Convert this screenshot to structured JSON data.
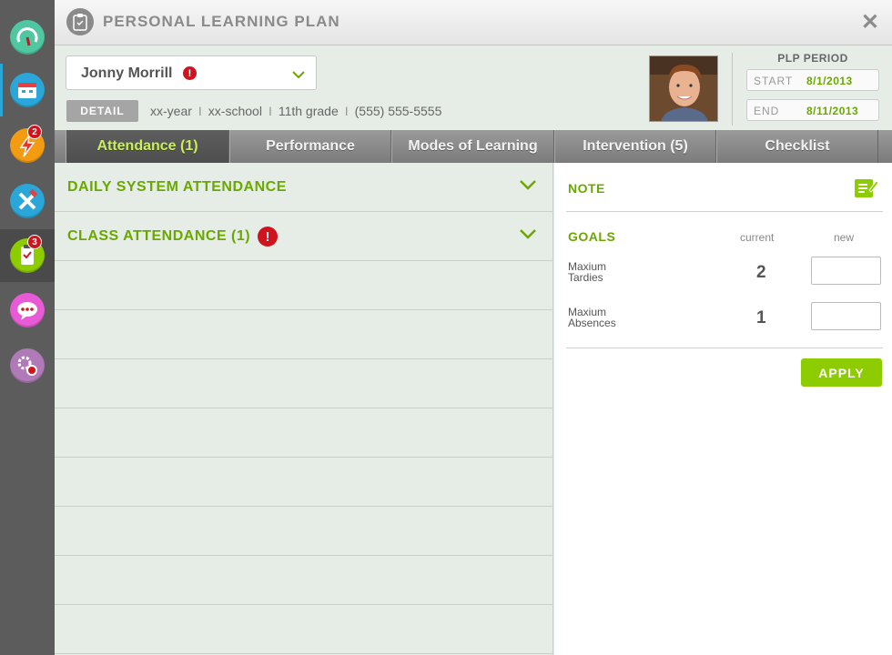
{
  "app": {
    "title": "PERSONAL LEARNING PLAN",
    "close_label": "✕"
  },
  "rail": {
    "items": [
      {
        "icon": "gauge-icon",
        "color": "#4fc7a0",
        "badge": ""
      },
      {
        "icon": "calendar-icon",
        "color": "#2aa7d8",
        "badge": ""
      },
      {
        "icon": "lightning-icon",
        "color": "#f39c12",
        "badge": "2"
      },
      {
        "icon": "tools-icon",
        "color": "#2aa7d8",
        "badge": ""
      },
      {
        "icon": "clipboard-icon",
        "color": "#8ccc00",
        "badge": "3"
      },
      {
        "icon": "chat-icon",
        "color": "#e85ad6",
        "badge": ""
      },
      {
        "icon": "settings-icon",
        "color": "#b07ab8",
        "badge": ""
      }
    ]
  },
  "student": {
    "name": "Jonny Morrill",
    "alert": "!",
    "detail_label": "DETAIL",
    "year": "xx-year",
    "school": "xx-school",
    "grade": "11th grade",
    "phone": "(555) 555-5555",
    "sep": "I"
  },
  "plp": {
    "label": "PLP PERIOD",
    "start_label": "START",
    "start_value": "8/1/2013",
    "end_label": "END",
    "end_value": "8/11/2013"
  },
  "tabs": [
    {
      "label": "Attendance (1)",
      "active": true
    },
    {
      "label": "Performance",
      "active": false
    },
    {
      "label": "Modes of Learning",
      "active": false
    },
    {
      "label": "Intervention (5)",
      "active": false
    },
    {
      "label": "Checklist",
      "active": false
    }
  ],
  "sections": [
    {
      "title": "DAILY SYSTEM ATTENDANCE",
      "alert": ""
    },
    {
      "title": "CLASS ATTENDANCE (1)",
      "alert": "!"
    }
  ],
  "right": {
    "note_label": "NOTE",
    "goals_label": "GOALS",
    "col_current": "current",
    "col_new": "new",
    "goals": [
      {
        "name_line1": "Maxium",
        "name_line2": "Tardies",
        "current": "2",
        "new": ""
      },
      {
        "name_line1": "Maxium",
        "name_line2": "Absences",
        "current": "1",
        "new": ""
      }
    ],
    "apply_label": "APPLY"
  },
  "colors": {
    "accent_green": "#6aa800",
    "button_green": "#8ccc00",
    "alert_red": "#d0141e",
    "active_tab_text": "#c9f05a"
  }
}
